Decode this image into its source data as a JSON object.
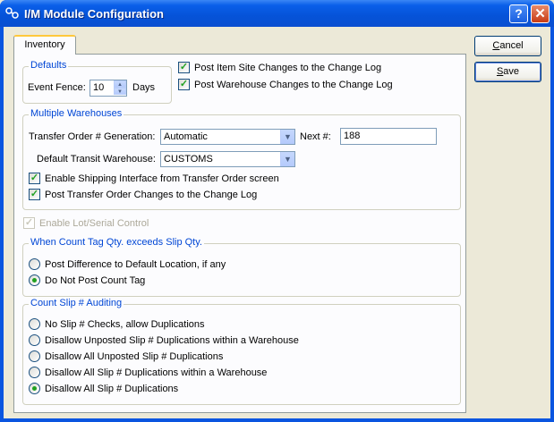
{
  "window": {
    "title": "I/M Module Configuration",
    "help_label": "?",
    "close_label": "✕"
  },
  "tabs": [
    {
      "label": "Inventory",
      "active": true
    }
  ],
  "buttons": {
    "cancel_first": "C",
    "cancel_rest": "ancel",
    "save_first": "S",
    "save_rest": "ave"
  },
  "defaults": {
    "legend": "Defaults",
    "event_fence_label": "Event Fence:",
    "event_fence_value": "10",
    "days_label": "Days",
    "post_itemsite_changes": {
      "label": "Post Item Site Changes to the Change Log",
      "checked": true
    },
    "post_warehouse_changes": {
      "label": "Post Warehouse Changes to the Change Log",
      "checked": true
    }
  },
  "multiple_warehouses": {
    "legend": "Multiple Warehouses",
    "to_generation_label": "Transfer Order # Generation:",
    "to_generation_value": "Automatic",
    "next_label": "Next #:",
    "next_value": "188",
    "transit_warehouse_label": "Default Transit Warehouse:",
    "transit_warehouse_value": "CUSTOMS",
    "enable_shipping": {
      "label": "Enable Shipping Interface from Transfer Order screen",
      "checked": true
    },
    "post_to_changes": {
      "label": "Post Transfer Order Changes to the Change Log",
      "checked": true
    }
  },
  "lot_serial": {
    "label": "Enable Lot/Serial Control",
    "checked": true,
    "disabled": true
  },
  "count_tag": {
    "legend": "When Count Tag Qty. exceeds Slip Qty.",
    "options": [
      {
        "label": "Post Difference to Default Location, if any",
        "selected": false
      },
      {
        "label": "Do Not Post Count Tag",
        "selected": true
      }
    ]
  },
  "count_slip": {
    "legend": "Count Slip # Auditing",
    "options": [
      {
        "label": "No Slip # Checks, allow Duplications",
        "selected": false
      },
      {
        "label": "Disallow Unposted Slip # Duplications within a Warehouse",
        "selected": false
      },
      {
        "label": "Disallow All Unposted Slip # Duplications",
        "selected": false
      },
      {
        "label": "Disallow All Slip # Duplications within a Warehouse",
        "selected": false
      },
      {
        "label": "Disallow All Slip # Duplications",
        "selected": true
      }
    ]
  },
  "colors": {
    "titlebar": "#0553d8",
    "face": "#ece9d8",
    "check": "#21a121",
    "legend": "#0046d5"
  }
}
